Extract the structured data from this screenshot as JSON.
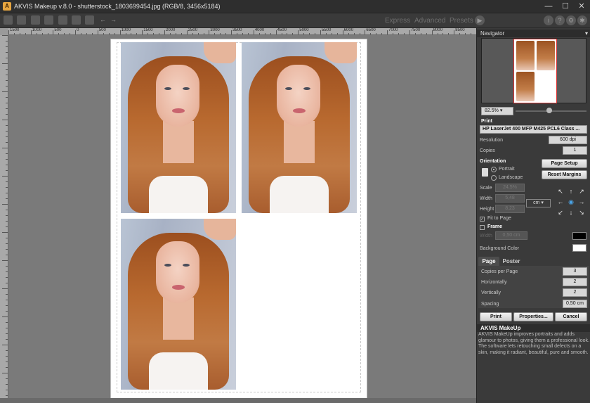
{
  "titlebar": {
    "app_icon": "A",
    "title": "AKVIS Makeup v.8.0 - shutterstock_1803699454.jpg (RGB/8, 3456x5184)",
    "minimize_glyph": "—",
    "maximize_glyph": "☐",
    "close_glyph": "✕"
  },
  "toolbar": {
    "modes": [
      "Express",
      "Advanced",
      "Presets"
    ],
    "icons": [
      "open-icon",
      "save-icon",
      "print-icon",
      "share-icon",
      "before-after-icon",
      "undo-icon",
      "redo-icon",
      "play-icon",
      "info-icon",
      "help-icon",
      "settings-icon",
      "preferences-icon"
    ],
    "undo_glyph": "←",
    "redo_glyph": "→",
    "play_glyph": "▶",
    "info_glyph": "i",
    "help_glyph": "?",
    "settings_glyph": "⚙",
    "prefs_glyph": "✱"
  },
  "ruler": {
    "h_labels": [
      "1500",
      "1000",
      "500",
      "0",
      "500",
      "1000",
      "1500",
      "2000",
      "2500",
      "3000",
      "3500",
      "4000",
      "4500",
      "5000",
      "5500",
      "6000",
      "6500",
      "7000",
      "7500",
      "8000",
      "8500"
    ]
  },
  "navigator": {
    "title": "Navigator",
    "collapse_glyph": "▾",
    "zoom": "82.5%",
    "zoom_glyph": "▾",
    "zoom_level": 0.48
  },
  "print": {
    "section_label": "Print",
    "printer": "HP LaserJet 400 MFP M425 PCL6 Class ...",
    "resolution_label": "Resolution",
    "resolution": "600 dpi",
    "copies_label": "Copies",
    "copies": "1",
    "orientation_label": "Orientation",
    "portrait": "Portrait",
    "landscape": "Landscape",
    "page_setup": "Page Setup",
    "reset_margins": "Reset Margins",
    "scale_label": "Scale",
    "scale": "24,5%",
    "width_label": "Width",
    "width": "5,48",
    "height_label": "Height",
    "height": "8,23",
    "unit": "cm",
    "fit_to_page": "Fit to Page",
    "fit_checked": true,
    "frame": "Frame",
    "frame_checked": false,
    "frame_width_label": "Width",
    "frame_width": "0,50 cm",
    "frame_color": "#000000",
    "bg_color_label": "Background Color",
    "bg_color": "#ffffff",
    "arrows": [
      "↖",
      "↑",
      "↗",
      "←",
      "◉",
      "→",
      "↙",
      "↓",
      "↘"
    ]
  },
  "tabs": [
    {
      "label": "Page",
      "active": true
    },
    {
      "label": "Poster",
      "active": false
    }
  ],
  "page_tab": {
    "copies_per_page_label": "Copies per Page",
    "copies_per_page": "3",
    "horizontally_label": "Horizontally",
    "horizontally": "2",
    "vertically_label": "Vertically",
    "vertically": "2",
    "spacing_label": "Spacing",
    "spacing": "0,50 cm"
  },
  "buttons": {
    "print": "Print",
    "properties": "Properties...",
    "cancel": "Cancel"
  },
  "about": {
    "title": "AKVIS MakeUp",
    "text": "AKVIS MakeUp improves portraits and adds glamour to photos, giving them a professional look. The software lets retouching small defects on a skin, making it radiant, beautiful, pure and smooth."
  }
}
